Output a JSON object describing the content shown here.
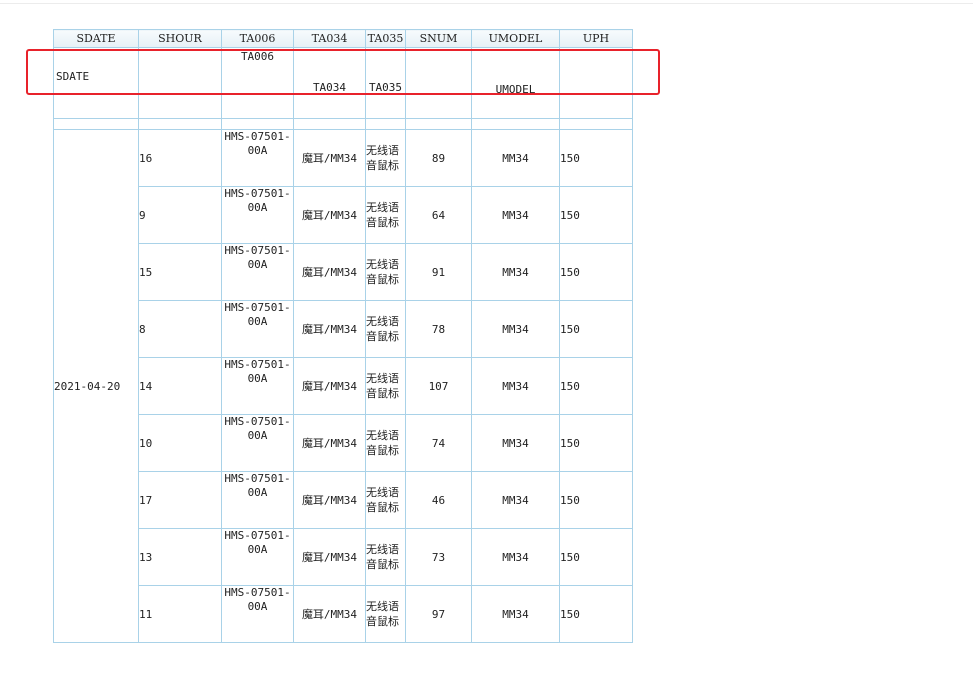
{
  "columns": [
    "SDATE",
    "SHOUR",
    "TA006",
    "TA034",
    "TA035",
    "SNUM",
    "UMODEL",
    "UPH"
  ],
  "filter_row": {
    "sdate": "SDATE",
    "shour": "",
    "ta006": "TA006",
    "ta034": "TA034",
    "ta035": "TA035",
    "snum": "",
    "umodel": "UMODEL",
    "uph": ""
  },
  "group_date": "2021-04-20",
  "rows": [
    {
      "shour": "16",
      "ta006": "HMS-07501-00A",
      "ta034": "魔耳/MM34",
      "ta035": "无线语音鼠标",
      "snum": "89",
      "umodel": "MM34",
      "uph": "150"
    },
    {
      "shour": "9",
      "ta006": "HMS-07501-00A",
      "ta034": "魔耳/MM34",
      "ta035": "无线语音鼠标",
      "snum": "64",
      "umodel": "MM34",
      "uph": "150"
    },
    {
      "shour": "15",
      "ta006": "HMS-07501-00A",
      "ta034": "魔耳/MM34",
      "ta035": "无线语音鼠标",
      "snum": "91",
      "umodel": "MM34",
      "uph": "150"
    },
    {
      "shour": "8",
      "ta006": "HMS-07501-00A",
      "ta034": "魔耳/MM34",
      "ta035": "无线语音鼠标",
      "snum": "78",
      "umodel": "MM34",
      "uph": "150"
    },
    {
      "shour": "14",
      "ta006": "HMS-07501-00A",
      "ta034": "魔耳/MM34",
      "ta035": "无线语音鼠标",
      "snum": "107",
      "umodel": "MM34",
      "uph": "150"
    },
    {
      "shour": "10",
      "ta006": "HMS-07501-00A",
      "ta034": "魔耳/MM34",
      "ta035": "无线语音鼠标",
      "snum": "74",
      "umodel": "MM34",
      "uph": "150"
    },
    {
      "shour": "17",
      "ta006": "HMS-07501-00A",
      "ta034": "魔耳/MM34",
      "ta035": "无线语音鼠标",
      "snum": "46",
      "umodel": "MM34",
      "uph": "150"
    },
    {
      "shour": "13",
      "ta006": "HMS-07501-00A",
      "ta034": "魔耳/MM34",
      "ta035": "无线语音鼠标",
      "snum": "73",
      "umodel": "MM34",
      "uph": "150"
    },
    {
      "shour": "11",
      "ta006": "HMS-07501-00A",
      "ta034": "魔耳/MM34",
      "ta035": "无线语音鼠标",
      "snum": "97",
      "umodel": "MM34",
      "uph": "150"
    }
  ],
  "colors": {
    "border": "#a9d2e8",
    "highlight": "#e8222b"
  }
}
